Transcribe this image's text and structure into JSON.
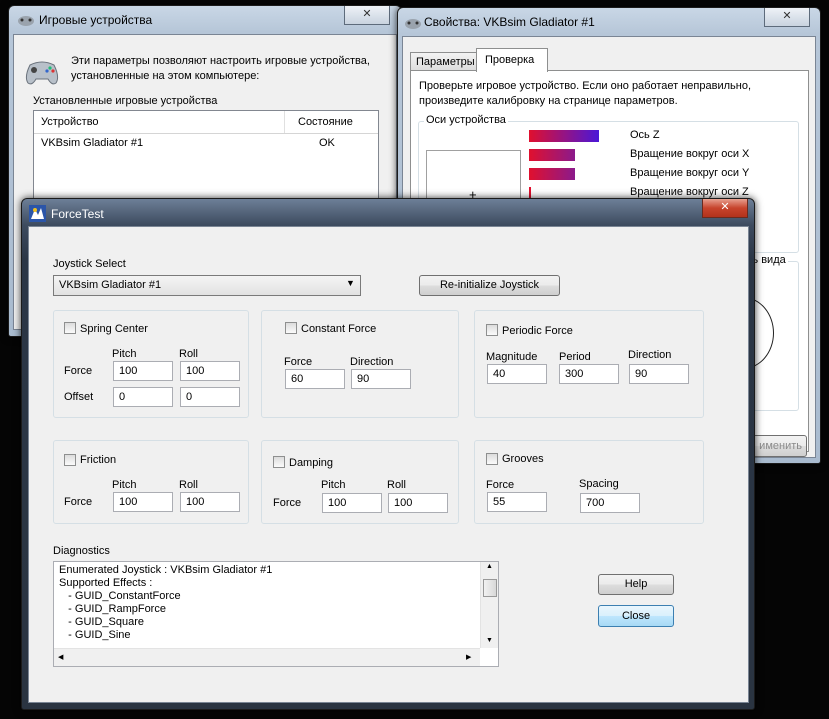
{
  "game_controllers": {
    "title": "Игровые устройства",
    "description_line1": "Эти параметры позволяют настроить игровые устройства,",
    "description_line2": "установленные на этом компьютере:",
    "installed_label": "Установленные игровые устройства",
    "columns": [
      "Устройство",
      "Состояние"
    ],
    "rows": [
      {
        "device": "VKBsim Gladiator #1",
        "status": "OK"
      }
    ]
  },
  "properties": {
    "title": "Свойства: VKBsim Gladiator #1",
    "tabs": [
      "Параметры",
      "Проверка"
    ],
    "active_tab": "Проверка",
    "instruction_line1": "Проверьте игровое устройство. Если оно работает неправильно,",
    "instruction_line2": "произведите калибровку на странице параметров.",
    "axes_group_label": "Оси устройства",
    "axes": [
      {
        "label": "Ось Z",
        "level": 0.55,
        "color": "#4a17d8"
      },
      {
        "label": "Вращение вокруг оси X",
        "level": 0.35,
        "color": "#8b1a8c"
      },
      {
        "label": "Вращение вокруг оси Y",
        "level": 0.35,
        "color": "#8b1a8c"
      },
      {
        "label": "Вращение вокруг оси Z",
        "level": 0.0,
        "color": "#e0102e"
      }
    ],
    "pov_label_partial": "ль вида",
    "apply_partial": "именить"
  },
  "forcetest": {
    "title": "ForceTest",
    "joystick_select_label": "Joystick Select",
    "joystick_selected": "VKBsim Gladiator #1",
    "reinit_button": "Re-initialize Joystick",
    "spring_center": {
      "label": "Spring Center",
      "pitch_label": "Pitch",
      "roll_label": "Roll",
      "force_label": "Force",
      "offset_label": "Offset",
      "force_pitch": "100",
      "force_roll": "100",
      "offset_pitch": "0",
      "offset_roll": "0"
    },
    "constant_force": {
      "label": "Constant Force",
      "force_label": "Force",
      "direction_label": "Direction",
      "force": "60",
      "direction": "90"
    },
    "periodic_force": {
      "label": "Periodic Force",
      "magnitude_label": "Magnitude",
      "period_label": "Period",
      "direction_label": "Direction",
      "magnitude": "40",
      "period": "300",
      "direction": "90"
    },
    "friction": {
      "label": "Friction",
      "pitch_label": "Pitch",
      "roll_label": "Roll",
      "force_label": "Force",
      "pitch": "100",
      "roll": "100"
    },
    "damping": {
      "label": "Damping",
      "pitch_label": "Pitch",
      "roll_label": "Roll",
      "force_label": "Force",
      "pitch": "100",
      "roll": "100"
    },
    "grooves": {
      "label": "Grooves",
      "force_label": "Force",
      "spacing_label": "Spacing",
      "force": "55",
      "spacing": "700"
    },
    "diagnostics_label": "Diagnostics",
    "diagnostics_lines": [
      "Enumerated Joystick : VKBsim Gladiator #1",
      "Supported Effects :",
      "   - GUID_ConstantForce",
      "   - GUID_RampForce",
      "   - GUID_Square",
      "   - GUID_Sine"
    ],
    "help_button": "Help",
    "close_button": "Close"
  },
  "colors": {
    "frame_dark": "#2b3646",
    "client_bg": "#f0f0f0",
    "close_red": "#c7442c",
    "focus_blue": "#3c7fb1"
  }
}
